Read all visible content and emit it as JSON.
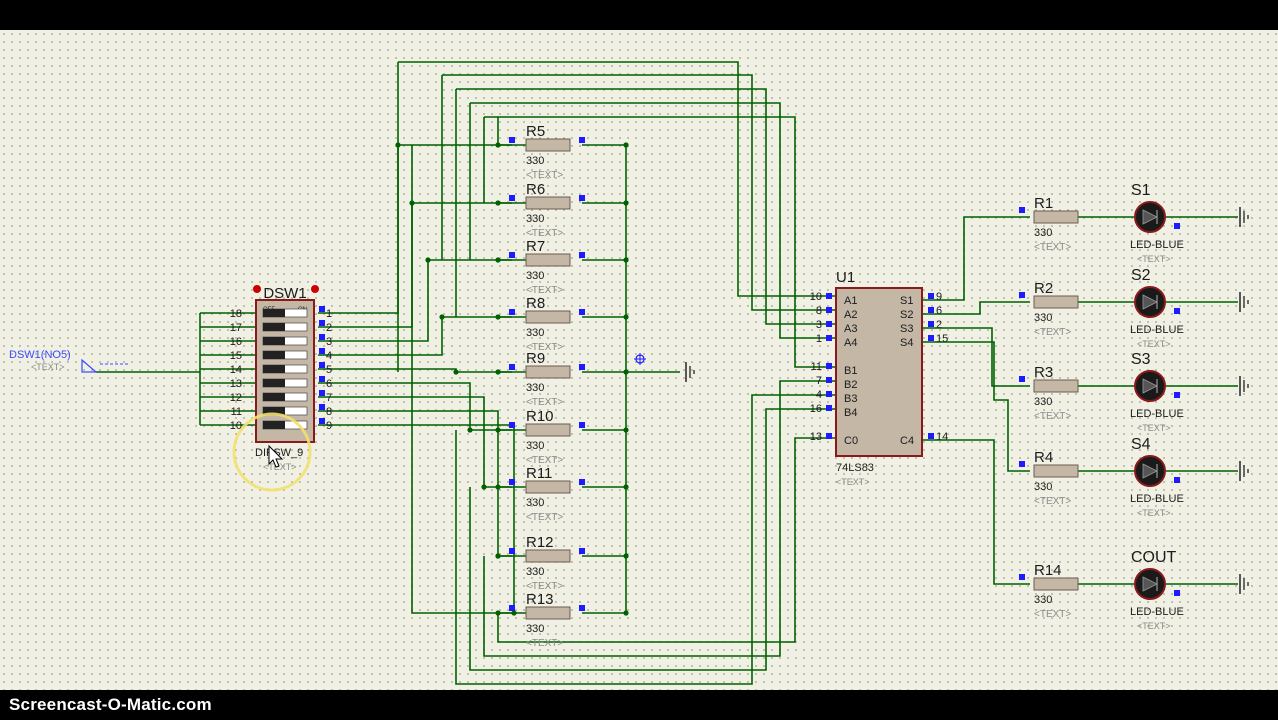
{
  "watermark": "Screencast-O-Matic.com",
  "colors": {
    "wire": "#006100",
    "body": "#c4b7a6",
    "body_edge": "#8a1a1a",
    "pin": "#1c1cff",
    "led": "#1a1a1a",
    "text": "#1c1c1c",
    "faint": "#8a8a8a"
  },
  "dipswitch": {
    "ref": "DSW1",
    "part": "DIPSW_9",
    "text": "<TEXT>",
    "off": "OFF",
    "on": "ON",
    "left_pins": [
      "18",
      "17",
      "16",
      "15",
      "14",
      "13",
      "12",
      "11",
      "10"
    ],
    "right_pins": [
      "1",
      "2",
      "3",
      "4",
      "5",
      "6",
      "7",
      "8",
      "9"
    ]
  },
  "probe": {
    "label": "DSW1(NO5)",
    "text": "<TEXT>"
  },
  "pulldowns": [
    {
      "ref": "R5",
      "value": "330",
      "text": "<TEXT>"
    },
    {
      "ref": "R6",
      "value": "330",
      "text": "<TEXT>"
    },
    {
      "ref": "R7",
      "value": "330",
      "text": "<TEXT>"
    },
    {
      "ref": "R8",
      "value": "330",
      "text": "<TEXT>"
    },
    {
      "ref": "R9",
      "value": "330",
      "text": "<TEXT>"
    },
    {
      "ref": "R10",
      "value": "330",
      "text": "<TEXT>"
    },
    {
      "ref": "R11",
      "value": "330",
      "text": "<TEXT>"
    },
    {
      "ref": "R12",
      "value": "330",
      "text": "<TEXT>"
    },
    {
      "ref": "R13",
      "value": "330",
      "text": "<TEXT>"
    }
  ],
  "chip": {
    "ref": "U1",
    "part": "74LS83",
    "text": "<TEXT>",
    "left_pins": [
      {
        "num": "10",
        "name": "A1"
      },
      {
        "num": "8",
        "name": "A2"
      },
      {
        "num": "3",
        "name": "A3"
      },
      {
        "num": "1",
        "name": "A4"
      },
      {
        "num": "11",
        "name": "B1"
      },
      {
        "num": "7",
        "name": "B2"
      },
      {
        "num": "4",
        "name": "B3"
      },
      {
        "num": "16",
        "name": "B4"
      },
      {
        "num": "13",
        "name": "C0"
      }
    ],
    "right_pins": [
      {
        "num": "9",
        "name": "S1"
      },
      {
        "num": "6",
        "name": "S2"
      },
      {
        "num": "2",
        "name": "S3"
      },
      {
        "num": "15",
        "name": "S4"
      },
      {
        "num": "14",
        "name": "C4"
      }
    ]
  },
  "outputs": [
    {
      "res": "R1",
      "value": "330",
      "text": "<TEXT>",
      "led": "S1",
      "led_part": "LED-BLUE",
      "led_text": "<TEXT>"
    },
    {
      "res": "R2",
      "value": "330",
      "text": "<TEXT>",
      "led": "S2",
      "led_part": "LED-BLUE",
      "led_text": "<TEXT>"
    },
    {
      "res": "R3",
      "value": "330",
      "text": "<TEXT>",
      "led": "S3",
      "led_part": "LED-BLUE",
      "led_text": "<TEXT>"
    },
    {
      "res": "R4",
      "value": "330",
      "text": "<TEXT>",
      "led": "S4",
      "led_part": "LED-BLUE",
      "led_text": "<TEXT>"
    },
    {
      "res": "R14",
      "value": "330",
      "text": "<TEXT>",
      "led": "COUT",
      "led_part": "LED-BLUE",
      "led_text": "<TEXT>"
    }
  ]
}
